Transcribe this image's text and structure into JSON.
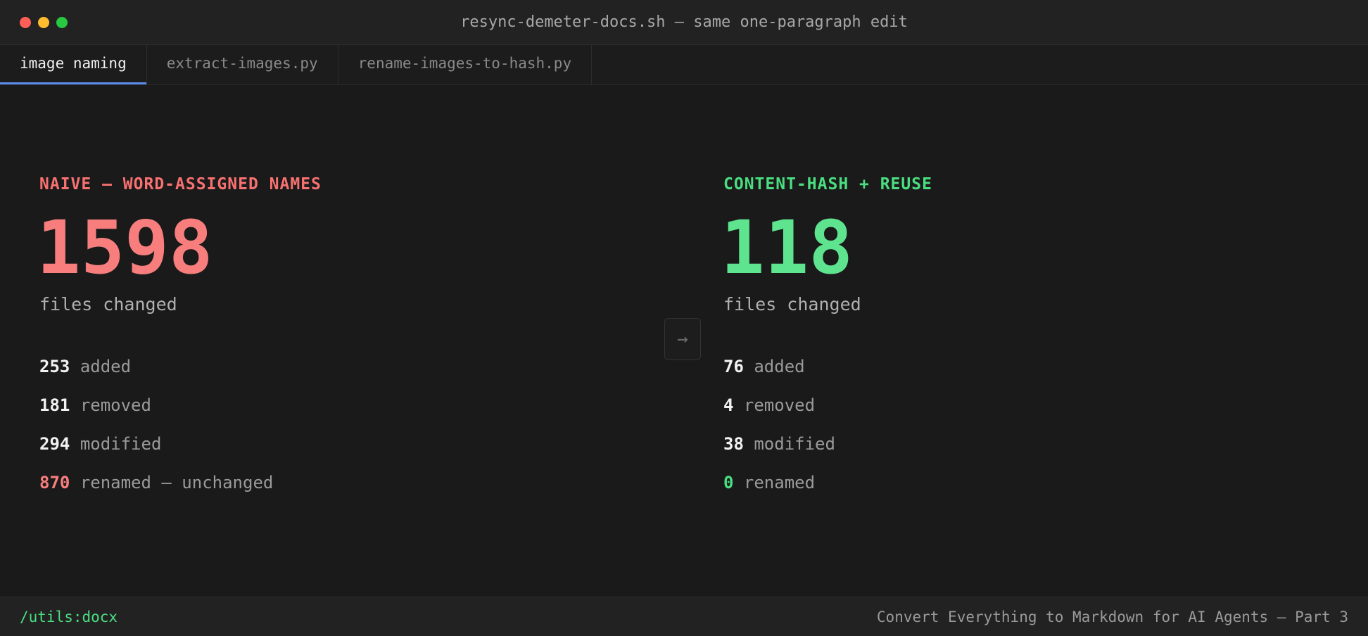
{
  "window": {
    "title": "resync-demeter-docs.sh — same one-paragraph edit"
  },
  "tabs": [
    {
      "label": "image naming",
      "active": true
    },
    {
      "label": "extract-images.py",
      "active": false
    },
    {
      "label": "rename-images-to-hash.py",
      "active": false
    }
  ],
  "left": {
    "heading": "NAIVE — WORD-ASSIGNED NAMES",
    "total": "1598",
    "total_label": "files changed",
    "stats": [
      {
        "num": "253",
        "label": "added"
      },
      {
        "num": "181",
        "label": "removed"
      },
      {
        "num": "294",
        "label": "modified"
      },
      {
        "num": "870",
        "label": "renamed — unchanged"
      }
    ]
  },
  "right": {
    "heading": "CONTENT-HASH + REUSE",
    "total": "118",
    "total_label": "files changed",
    "stats": [
      {
        "num": "76",
        "label": "added"
      },
      {
        "num": "4",
        "label": "removed"
      },
      {
        "num": "38",
        "label": "modified"
      },
      {
        "num": "0",
        "label": "renamed"
      }
    ]
  },
  "arrow": "→",
  "footer": {
    "left": "/utils:docx",
    "right": "Convert Everything to Markdown for AI Agents — Part 3"
  },
  "colors": {
    "accent_blue": "#5b8def",
    "naive_red": "#f87171",
    "hash_green": "#4ade80",
    "background": "#1a1a1a"
  },
  "icons": {
    "close": "close-traffic-light-icon",
    "minimize": "minimize-traffic-light-icon",
    "zoom": "zoom-traffic-light-icon",
    "arrow": "arrow-right-icon"
  }
}
